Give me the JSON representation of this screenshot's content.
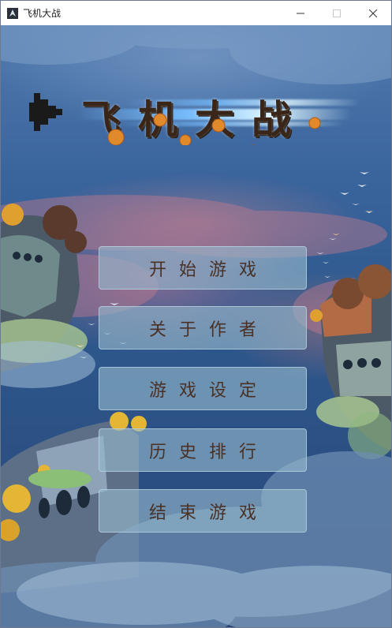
{
  "window": {
    "title": "飞机大战",
    "icon": "plane-app-icon",
    "controls": [
      "minimize",
      "maximize",
      "close"
    ]
  },
  "logo": {
    "text": "飞机大战"
  },
  "menu": {
    "items": [
      {
        "label": "开始游戏"
      },
      {
        "label": "关于作者"
      },
      {
        "label": "游戏设定"
      },
      {
        "label": "历史排行"
      },
      {
        "label": "结束游戏"
      }
    ]
  },
  "colors": {
    "sky_top": "#4f79ad",
    "sky_bottom": "#284575",
    "button_bg": "#96b9cd",
    "button_text": "#4a3126"
  }
}
